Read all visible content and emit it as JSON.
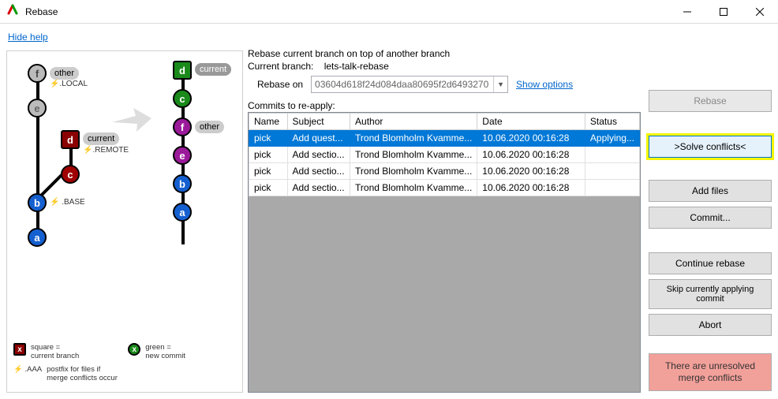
{
  "window": {
    "title": "Rebase"
  },
  "help_link": "Hide help",
  "info": {
    "line1": "Rebase current branch on top of another branch",
    "current_branch_label": "Current branch:",
    "current_branch": "lets-talk-rebase",
    "rebase_on_label": "Rebase on",
    "rebase_on_value": "03604d618f24d084daa80695f2d6493270",
    "show_options": "Show options",
    "commits_label": "Commits to re-apply:"
  },
  "table": {
    "headers": {
      "name": "Name",
      "subject": "Subject",
      "author": "Author",
      "date": "Date",
      "status": "Status"
    },
    "rows": [
      {
        "name": "pick",
        "subject": "Add quest...",
        "author": "Trond Blomholm Kvamme...",
        "date": "10.06.2020 00:16:28",
        "status": "Applying..."
      },
      {
        "name": "pick",
        "subject": "Add sectio...",
        "author": "Trond Blomholm Kvamme...",
        "date": "10.06.2020 00:16:28",
        "status": ""
      },
      {
        "name": "pick",
        "subject": "Add sectio...",
        "author": "Trond Blomholm Kvamme...",
        "date": "10.06.2020 00:16:28",
        "status": ""
      },
      {
        "name": "pick",
        "subject": "Add sectio...",
        "author": "Trond Blomholm Kvamme...",
        "date": "10.06.2020 00:16:28",
        "status": ""
      }
    ]
  },
  "buttons": {
    "rebase": "Rebase",
    "solve": ">Solve conflicts<",
    "add_files": "Add files",
    "commit": "Commit...",
    "continue": "Continue rebase",
    "skip": "Skip currently applying commit",
    "abort": "Abort",
    "conflict_msg": "There are unresolved merge conflicts"
  },
  "graph": {
    "left_label_other": "other",
    "left_sub_local": "⚡.LOCAL",
    "left_label_current": "current",
    "left_sub_remote": "⚡.REMOTE",
    "left_sub_base": "⚡ .BASE",
    "right_label_current": "current",
    "right_label_other": "other",
    "legend_square": "square =\ncurrent branch",
    "legend_green": "green =\nnew commit",
    "legend_postfix": "postfix for files if\nmerge conflicts occur",
    "legend_aaa": "⚡ .AAA"
  }
}
